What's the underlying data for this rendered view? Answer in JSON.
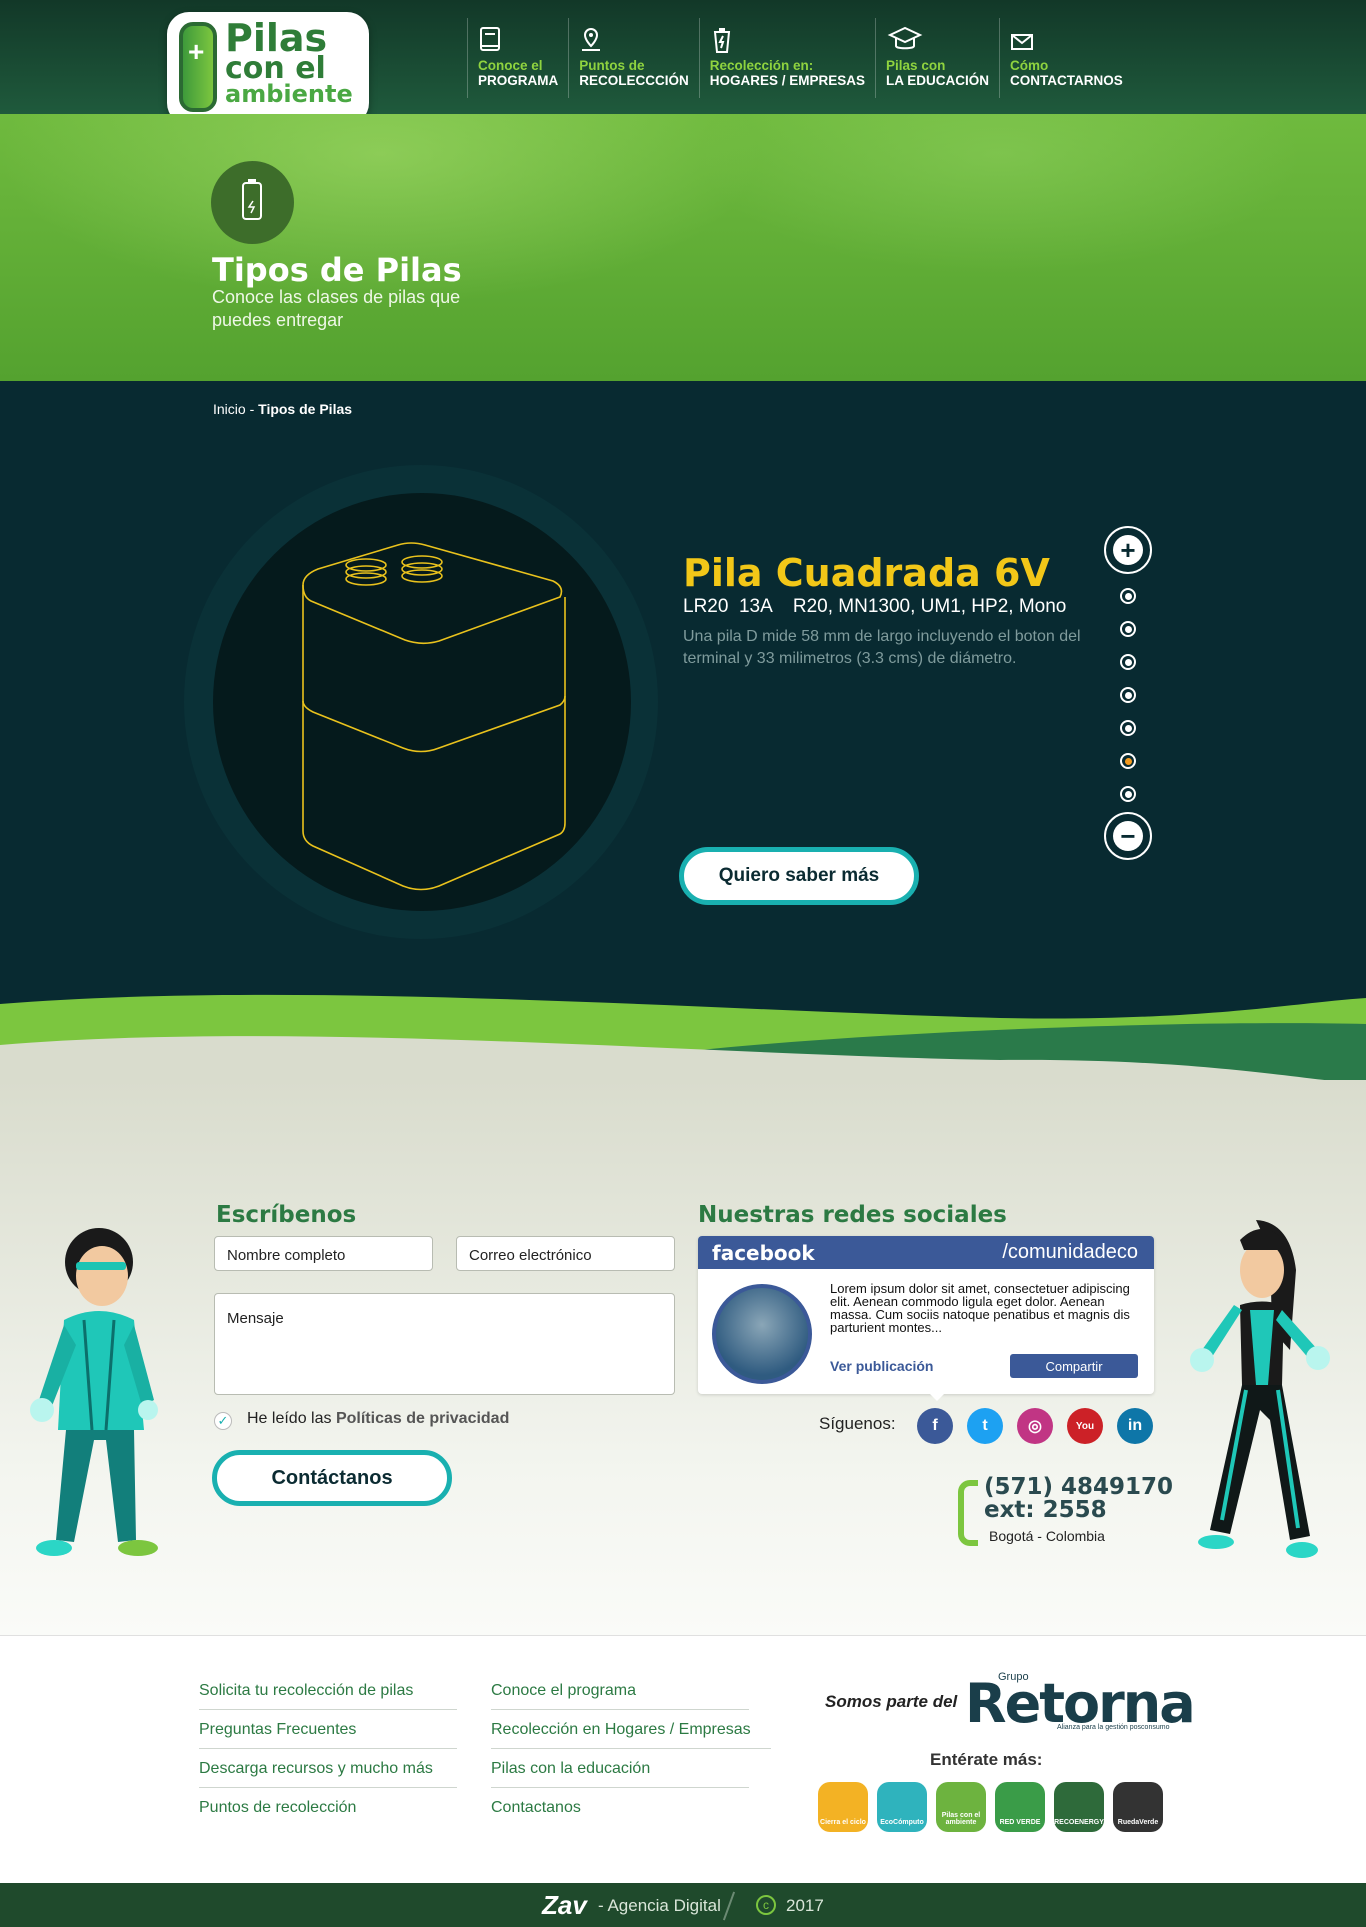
{
  "header": {
    "logo": {
      "line1": "Pilas",
      "line2": "con el",
      "line3": "ambiente"
    },
    "nav": [
      {
        "top": "Conoce el",
        "bottom": "PROGRAMA",
        "icon": "book-icon"
      },
      {
        "top": "Puntos de",
        "bottom": "RECOLECCCIÓN",
        "icon": "map-pin-icon"
      },
      {
        "top": "Recolección en:",
        "bottom": "HOGARES / EMPRESAS",
        "icon": "battery-bin-icon"
      },
      {
        "top": "Pilas con",
        "bottom": "LA EDUCACIÓN",
        "icon": "graduation-cap-icon"
      },
      {
        "top": "Cómo",
        "bottom": "CONTACTARNOS",
        "icon": "envelope-icon"
      }
    ]
  },
  "hero": {
    "title": "Tipos de Pilas",
    "subtitle": "Conoce las clases de pilas que puedes entregar",
    "icon": "battery-icon"
  },
  "breadcrumb": {
    "home": "Inicio",
    "separator": " - ",
    "current": "Tipos de Pilas"
  },
  "battery": {
    "name": "Pila Cuadrada 6V",
    "codes": "LR20  13A    R20, MN1300, UM1, HP2, Mono",
    "description": "Una pila D mide  58 mm de largo incluyendo el boton del terminal y  33 milimetros (3.3 cms) de diámetro.",
    "cta": "Quiero saber más",
    "pager": {
      "prev": "+",
      "next": "−",
      "count": 7,
      "active_index": 5
    }
  },
  "contact": {
    "heading": "Escríbenos",
    "name_placeholder": "Nombre completo",
    "email_placeholder": "Correo electrónico",
    "message_placeholder": "Mensaje",
    "privacy_prefix": "He leído las",
    "privacy_link": "Políticas de privacidad",
    "submit": "Contáctanos"
  },
  "social": {
    "heading": "Nuestras redes sociales",
    "fb_logo": "facebook",
    "fb_page": "/comunidadeco",
    "fb_text": "Lorem ipsum dolor sit amet, consectetuer adipiscing elit. Aenean commodo ligula eget dolor. Aenean massa. Cum sociis natoque penatibus et magnis dis parturient montes...",
    "fb_link": "Ver publicación",
    "fb_share": "Compartir",
    "follow": "Síguenos:",
    "networks": [
      {
        "name": "facebook-icon",
        "label": "f",
        "color": "#3b5998"
      },
      {
        "name": "twitter-icon",
        "label": "t",
        "color": "#1da1f2"
      },
      {
        "name": "instagram-icon",
        "label": "◎",
        "color": "#c13584"
      },
      {
        "name": "youtube-icon",
        "label": "You",
        "color": "#cc2127"
      },
      {
        "name": "linkedin-icon",
        "label": "in",
        "color": "#0e76a8"
      }
    ]
  },
  "phone": {
    "number": "(571) 4849170",
    "ext": "ext: 2558",
    "city": "Bogotá - Colombia"
  },
  "footer": {
    "col1": [
      "Solicita tu recolección de pilas",
      "Preguntas Frecuentes",
      "Descarga recursos y mucho más",
      "Puntos de recolección"
    ],
    "col2": [
      "Conoce el programa",
      "Recolección en Hogares / Empresas",
      "Pilas con la educación",
      "Contactanos"
    ],
    "somos": "Somos parte del",
    "retorna_grupo": "Grupo",
    "retorna": "Retorna",
    "retorna_sub": "Alianza para la gestión posconsumo",
    "enterate": "Entérate más:",
    "partners": [
      {
        "name": "Cierra el ciclo",
        "color": "#f3b224"
      },
      {
        "name": "EcoCómputo",
        "color": "#2fb3bd"
      },
      {
        "name": "Pilas con el ambiente",
        "color": "#6db33f"
      },
      {
        "name": "RED VERDE",
        "color": "#3a9c48"
      },
      {
        "name": "RECOENERGY",
        "color": "#2e6a3a"
      },
      {
        "name": "RuedaVerde",
        "color": "#333333"
      }
    ]
  },
  "bottom": {
    "brand": "Zav",
    "agency": "- Agencia Digital",
    "copyright": "c",
    "year": "2017"
  }
}
